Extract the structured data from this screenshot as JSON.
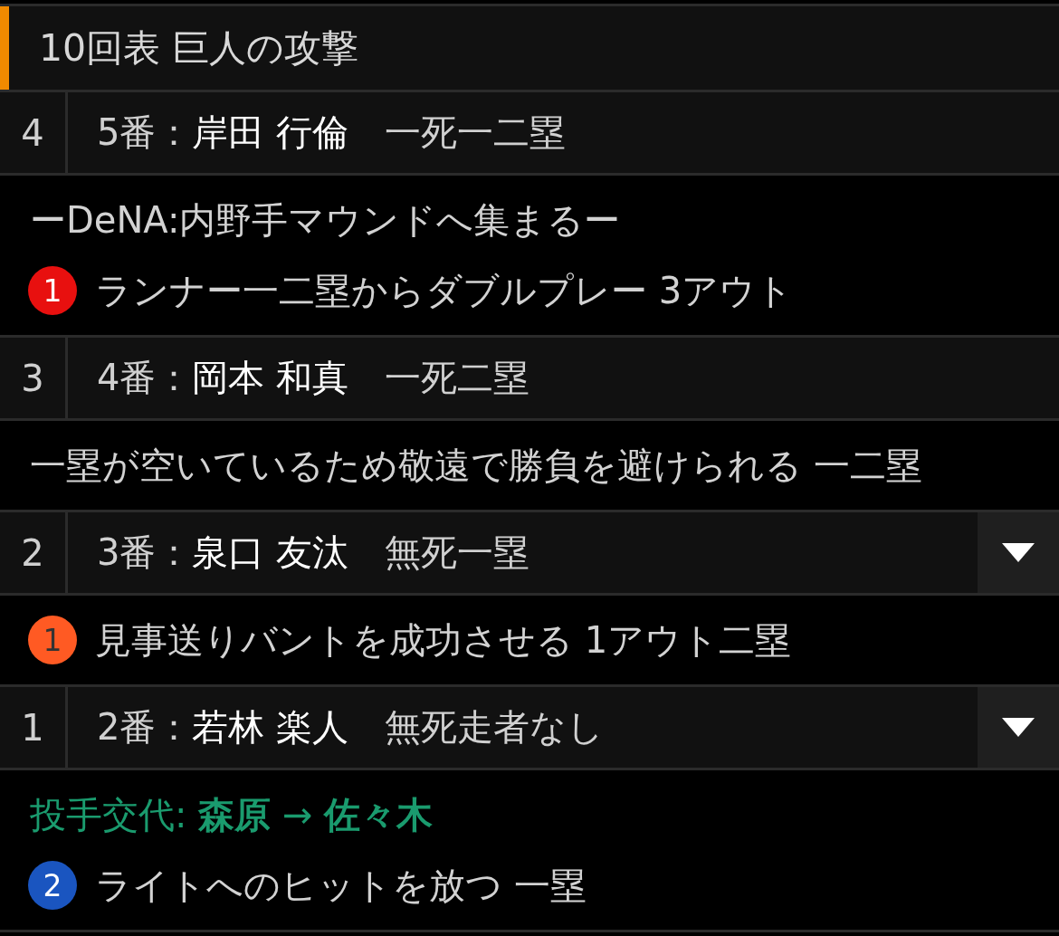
{
  "inning": {
    "title": "10回表 巨人の攻撃"
  },
  "at_bats": [
    {
      "number": "4",
      "order": "5番：",
      "name": "岸田 行倫",
      "situation": "一死一二塁",
      "dropdown": false,
      "events": [
        {
          "kind": "note",
          "text": "ーDeNA:内野手マウンドへ集まるー"
        },
        {
          "kind": "play",
          "badge": "1",
          "color": "#e8100f",
          "text": "ランナー一二塁からダブルプレー 3アウト"
        }
      ]
    },
    {
      "number": "3",
      "order": "4番：",
      "name": "岡本 和真",
      "situation": "一死二塁",
      "dropdown": false,
      "events": [
        {
          "kind": "note",
          "text": "一塁が空いているため敬遠で勝負を避けられる 一二塁"
        }
      ]
    },
    {
      "number": "2",
      "order": "3番：",
      "name": "泉口 友汰",
      "situation": "無死一塁",
      "dropdown": true,
      "events": [
        {
          "kind": "play",
          "badge": "1",
          "color": "#ff5a23",
          "text": "見事送りバントを成功させる 1アウト二塁"
        }
      ]
    },
    {
      "number": "1",
      "order": "2番：",
      "name": "若林 楽人",
      "situation": "無死走者なし",
      "dropdown": true,
      "events": [
        {
          "kind": "change",
          "text": "投手交代: **森原** → **佐々木**"
        },
        {
          "kind": "play",
          "badge": "2",
          "color": "#1a55c0",
          "text": "ライトへのヒットを放つ 一塁"
        }
      ]
    }
  ]
}
